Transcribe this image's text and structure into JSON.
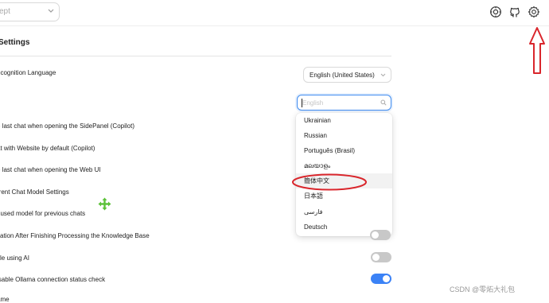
{
  "colors": {
    "accent": "#3b82f6",
    "annotation_red": "#d9262c",
    "move_cursor_green": "#5cc23a"
  },
  "header": {
    "model_select_value": "ept",
    "icons": [
      "settings-sliders-icon",
      "github-icon",
      "gear-icon"
    ]
  },
  "settings": {
    "title": "Settings",
    "rows": [
      "ecognition Language",
      "e last chat when opening the SidePanel (Copilot)",
      "at with Website by default (Copilot)",
      "e last chat when opening the Web UI",
      "rrent Chat Model Settings",
      "t used model for previous chats",
      "cation After Finishing Processing the Knowledge Base",
      "itle using AI",
      "isable Ollama connection status check",
      "ame"
    ],
    "recognition_language_value": "English (United States)",
    "toggles": {
      "knowledge_base_notification": false,
      "title_using_ai": false,
      "disable_ollama_check": true
    }
  },
  "language_dropdown": {
    "search_placeholder": "English",
    "options": [
      "Ukrainian",
      "Russian",
      "Português (Brasil)",
      "മലയാളം",
      "簡体中文",
      "日本語",
      "فارسی",
      "Deutsch"
    ],
    "highlighted_index": 4
  },
  "watermark": "CSDN @零炻大礼包"
}
